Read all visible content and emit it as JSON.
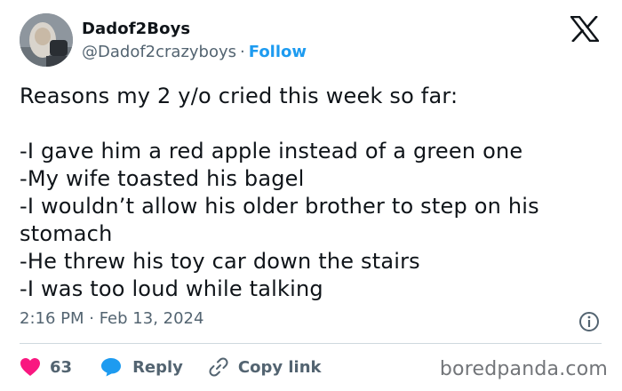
{
  "author": {
    "display_name": "Dadof2Boys",
    "handle": "@Dadof2crazyboys",
    "separator": "·",
    "follow_label": "Follow"
  },
  "tweet": {
    "lines": [
      "Reasons my 2 y/o cried this week so far:",
      "",
      "-I gave him a red apple instead of a green one",
      "-My wife toasted his bagel",
      "-I wouldn’t allow his older brother to step on his",
      "stomach",
      "-He threw his toy car down the stairs",
      "-I was too loud while talking"
    ],
    "timestamp": "2:16 PM · Feb 13, 2024"
  },
  "actions": {
    "like_count": "63",
    "reply_label": "Reply",
    "copy_link_label": "Copy link"
  },
  "watermark": "boredpanda.com",
  "colors": {
    "like": "#f91880",
    "reply": "#1d9bf0",
    "follow": "#1d9bf0",
    "muted": "#536471",
    "divider": "#cfd9de"
  },
  "icons": [
    "x-logo-icon",
    "info-icon",
    "heart-icon",
    "reply-bubble-icon",
    "link-icon"
  ]
}
